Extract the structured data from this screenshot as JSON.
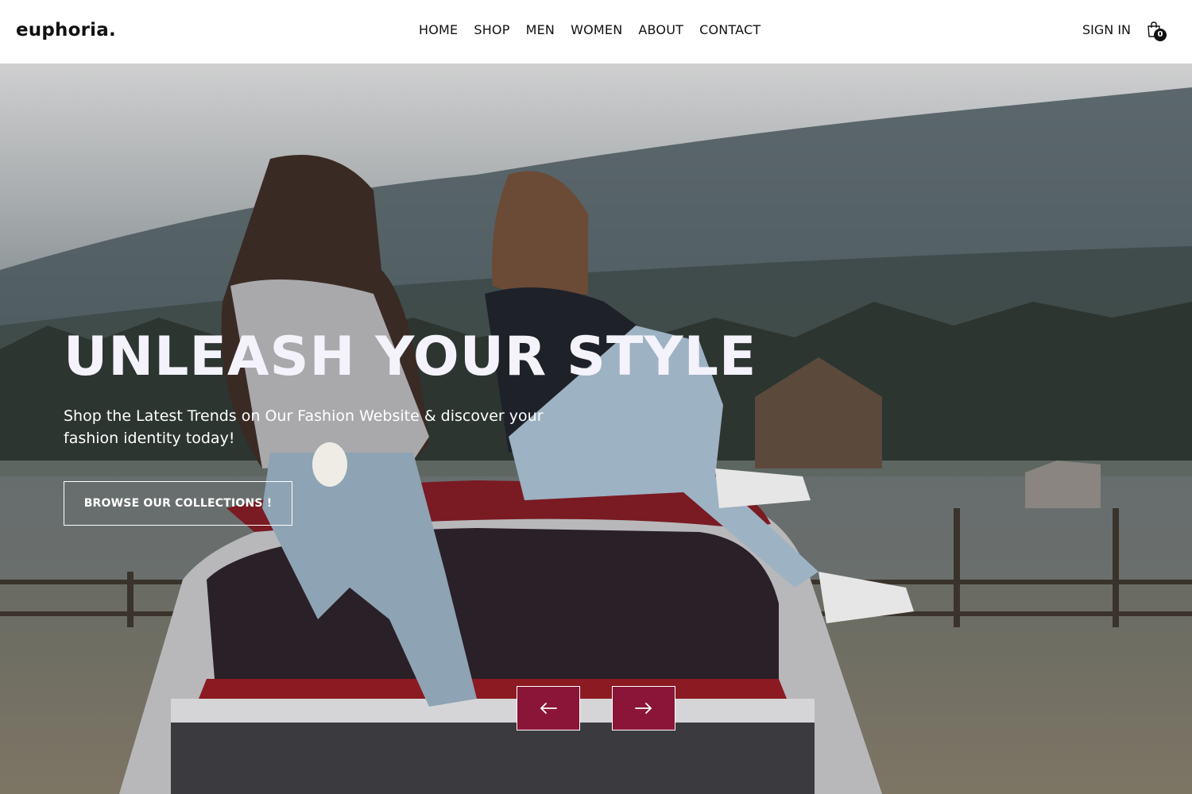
{
  "header": {
    "logo": "euphoria.",
    "nav": [
      {
        "label": "HOME"
      },
      {
        "label": "SHOP"
      },
      {
        "label": "MEN"
      },
      {
        "label": "WOMEN"
      },
      {
        "label": "ABOUT"
      },
      {
        "label": "CONTACT"
      }
    ],
    "signin_label": "SIGN IN",
    "cart_count": "0",
    "cart_icon": "shopping-bag-icon"
  },
  "hero": {
    "title": "UNLEASH YOUR STYLE",
    "subtitle": "Shop the Latest Trends on Our Fashion Website & discover your fashion identity today!",
    "cta_label": "BROWSE OUR COLLECTIONS !",
    "prev_icon": "arrow-left-icon",
    "next_icon": "arrow-right-icon"
  },
  "colors": {
    "accent": "#8b1538",
    "title": "#f4f2fb",
    "header_bg": "#ffffff",
    "text": "#111111"
  }
}
